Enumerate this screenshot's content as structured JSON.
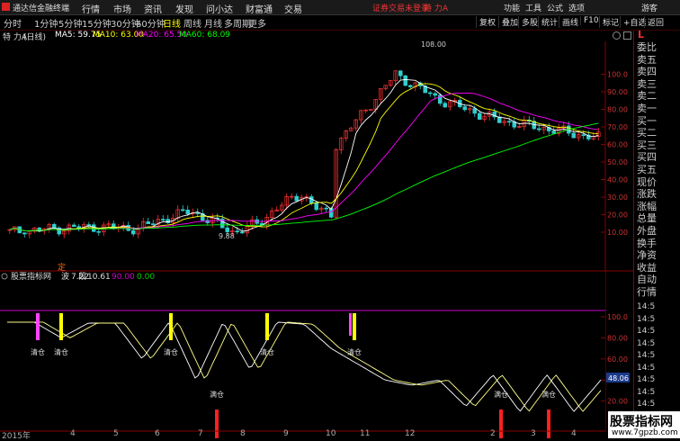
{
  "titlebar": {
    "app_name": "通达信金融终端",
    "menu": [
      "行情",
      "市场",
      "资讯",
      "发现",
      "问小达",
      "财富通",
      "交易"
    ],
    "warning": "证券交易未登录",
    "stock_name": "特 力A",
    "right": [
      "功能",
      "工具",
      "公式",
      "选项"
    ],
    "guest": "游客"
  },
  "toolbar": {
    "periods": [
      "分时",
      "1分钟",
      "5分钟",
      "15分钟",
      "30分钟",
      "60分钟",
      "日线",
      "周线",
      "月线",
      "多周期",
      "更多"
    ],
    "active_period": "日线",
    "right_buttons": [
      "复权",
      "叠加",
      "多股",
      "统计",
      "画线",
      "F10",
      "标记",
      "+自选",
      "返回"
    ]
  },
  "main_chart": {
    "title": "特 力A",
    "period": "(日线)",
    "ma": [
      {
        "label": "MA5: 59.75",
        "color": "#ffffff"
      },
      {
        "label": "MA10: 63.00",
        "color": "#ffff00"
      },
      {
        "label": "MA20: 65.50",
        "color": "#ff00ff"
      },
      {
        "label": "MA60: 68.09",
        "color": "#00ff00"
      }
    ],
    "high_label": "108.00",
    "low_label": "9.88",
    "y_ticks": [
      "100.0",
      "90.00",
      "80.00",
      "70.00",
      "60.00",
      "50.00",
      "40.00",
      "30.00",
      "20.00",
      "10.00"
    ]
  },
  "indicator": {
    "name": "股票指标网",
    "wave_label": "波",
    "wave_value": "7.22",
    "segment_label": "段",
    "segment_value": "10.61",
    "level_high": "90.00",
    "level_low": "0.00",
    "badge": "定",
    "current_value": "48.06",
    "y_ticks": [
      "100.0",
      "80.00",
      "60.00",
      "40.00",
      "20.00"
    ],
    "sell_label": "满仓",
    "buy_label": "清仓"
  },
  "x_axis": {
    "labels": [
      "2015年",
      "4",
      "5",
      "6",
      "7",
      "8",
      "9",
      "10",
      "11",
      "12",
      "2",
      "3",
      "4"
    ]
  },
  "side_panel": {
    "top_letter": "L",
    "items": [
      "委比",
      "卖五",
      "卖四",
      "卖三",
      "卖二",
      "卖一",
      "买一",
      "买二",
      "买三",
      "买四",
      "买五",
      "现价",
      "涨跌",
      "涨幅",
      "总量",
      "外盘",
      "换手",
      "净资",
      "收益",
      "自动",
      "行情"
    ],
    "times": [
      "14:5",
      "14:5",
      "14:5",
      "14:5",
      "14:5",
      "14:5",
      "14:5",
      "14:5",
      "14:5",
      "14:5",
      "14:5"
    ]
  },
  "watermark": {
    "line1": "股票指标网",
    "line2": "www.7gpzb.com"
  },
  "chart_data": {
    "type": "line",
    "title": "特 力A (日线)",
    "series": [
      {
        "name": "MA5",
        "color": "#ffffff",
        "values": [
          10,
          12,
          11,
          14,
          18,
          22,
          26,
          30,
          28,
          33,
          45,
          60,
          80,
          70,
          100,
          90,
          92,
          84,
          76,
          72,
          70,
          70,
          68,
          60
        ]
      },
      {
        "name": "MA60",
        "color": "#00ff00",
        "values": [
          12,
          12,
          13,
          14,
          15,
          17,
          19,
          20,
          21,
          22,
          30,
          40,
          50,
          60,
          70,
          76,
          78,
          80,
          82,
          78,
          74,
          72,
          70,
          68
        ]
      },
      {
        "name": "波",
        "values": [
          95,
          95,
          80,
          94,
          94,
          60,
          95,
          40,
          95,
          50,
          95,
          93,
          70,
          55,
          40,
          35,
          40,
          15,
          45,
          10,
          45,
          10,
          40
        ]
      }
    ],
    "ylim": [
      0,
      110
    ]
  }
}
